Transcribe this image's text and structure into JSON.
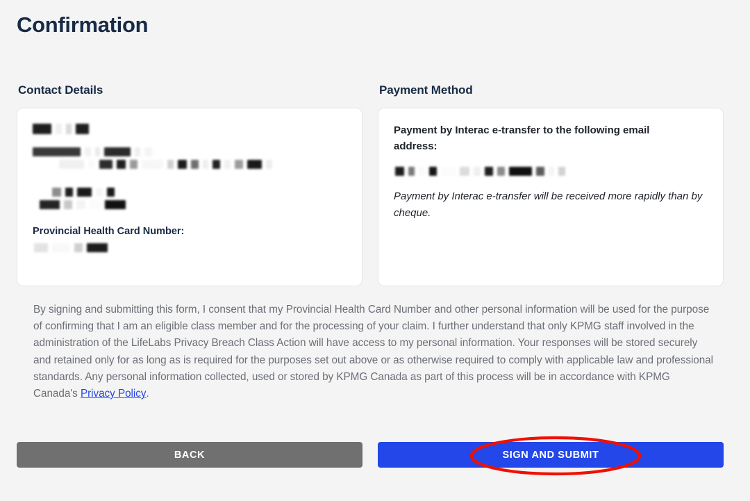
{
  "page": {
    "title": "Confirmation",
    "background_color": "#f4f4f4",
    "heading_color": "#182a45"
  },
  "contact_section": {
    "heading": "Contact Details",
    "health_card_label": "Provincial Health Card Number:",
    "redacted": true,
    "redaction_note": "Personal contact information is pixelated/redacted in the screenshot"
  },
  "payment_section": {
    "heading": "Payment Method",
    "method_label": "Payment by Interac e-transfer to the following email address:",
    "email_redacted": true,
    "note": "Payment by Interac e-transfer will be received more rapidly than by cheque."
  },
  "consent": {
    "text_before_link": "By signing and submitting this form, I consent that my Provincial Health Card Number and other personal information will be used for the purpose of confirming that I am an eligible class member and for the processing of your claim. I further understand that only KPMG staff involved in the administration of the LifeLabs Privacy Breach Class Action will have access to my personal information. Your responses will be stored securely and retained only for as long as is required for the purposes set out above or as otherwise required to comply with applicable law and professional standards. Any personal information collected, used or stored by KPMG Canada as part of this process will be in accordance with KPMG Canada's ",
    "link_label": "Privacy Policy",
    "text_after_link": ".",
    "link_color": "#2347e8",
    "text_color": "#6b6f76"
  },
  "actions": {
    "back_label": "BACK",
    "back_color": "#707070",
    "submit_label": "SIGN AND SUBMIT",
    "submit_color": "#2347e8"
  },
  "annotation": {
    "shape": "ellipse",
    "color": "#f01000",
    "target": "SIGN AND SUBMIT"
  }
}
